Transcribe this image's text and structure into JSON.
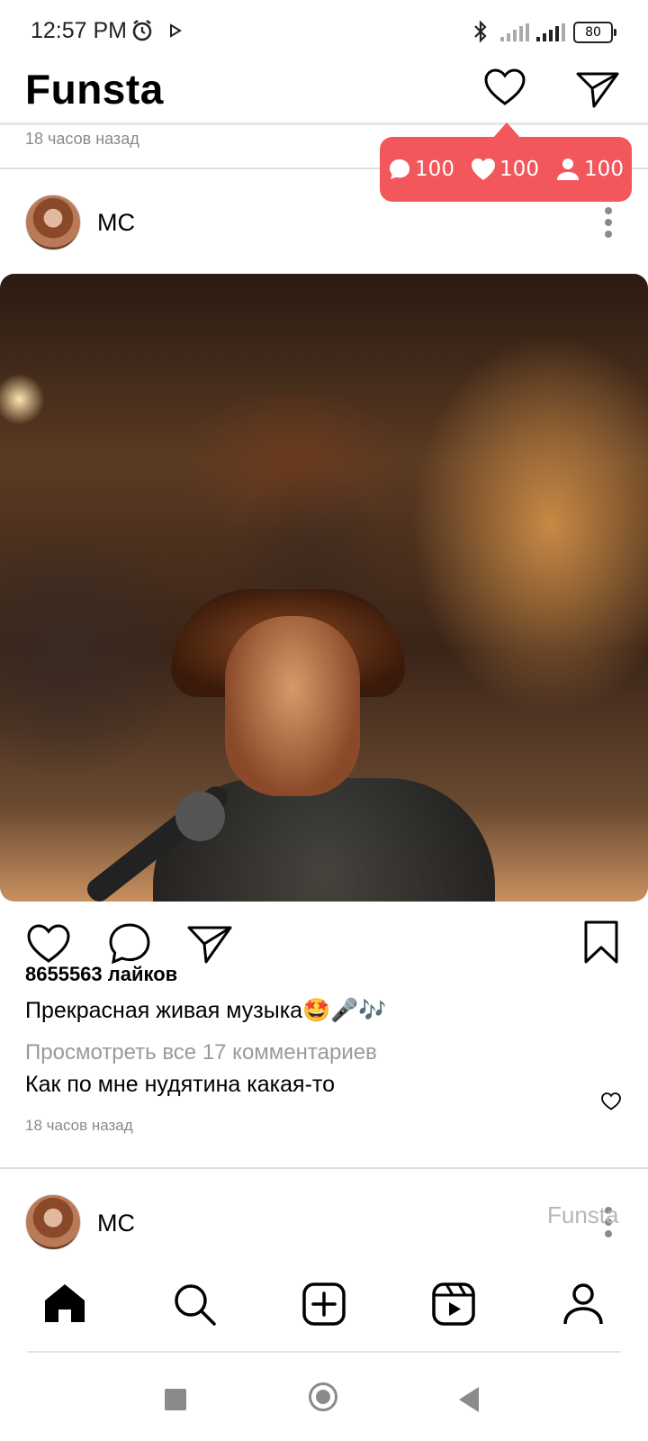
{
  "status_bar": {
    "time": "12:57 PM",
    "battery": "80"
  },
  "header": {
    "title": "Funsta"
  },
  "previous_post": {
    "time_ago": "18 часов назад"
  },
  "notifications_tooltip": {
    "comments": "100",
    "likes": "100",
    "followers": "100",
    "color": "#f2575b"
  },
  "post": {
    "username": "МС",
    "likes": "8655563 лайков",
    "caption": "Прекрасная живая музыка🤩🎤🎶",
    "view_comments": "Просмотреть все 17 комментариев",
    "top_comment": "Как по мне нудятина какая-то",
    "time_ago": "18 часов назад"
  },
  "next_post": {
    "username": "МС"
  },
  "watermark": "Funsta",
  "bottom_nav": {
    "items": [
      "home-icon",
      "search-icon",
      "add-post-icon",
      "reels-icon",
      "profile-icon"
    ]
  }
}
